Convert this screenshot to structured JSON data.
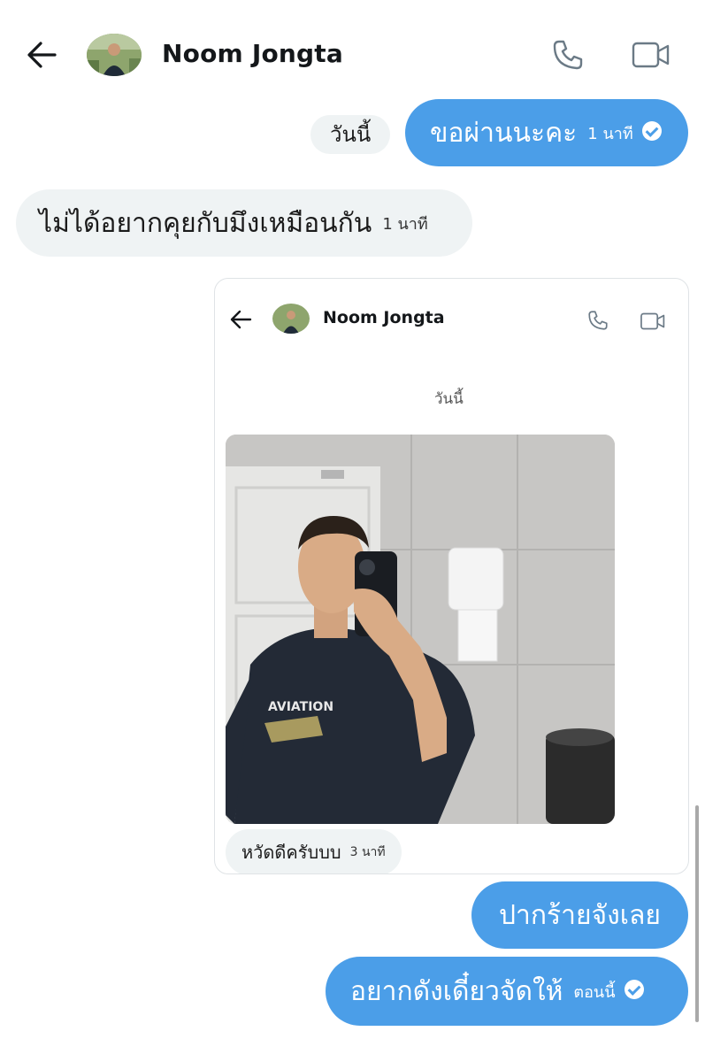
{
  "header": {
    "contact_name": "Noom Jongta",
    "icons": [
      "back-arrow-icon",
      "phone-icon",
      "video-camera-icon"
    ]
  },
  "day_label": "วันนี้",
  "messages": [
    {
      "side": "sent",
      "text": "ขอผ่านนะคะ",
      "time": "1 นาที",
      "status": "read"
    },
    {
      "side": "received",
      "text": "ไม่ได้อยากคุยกับมึงเหมือนกัน",
      "time": "1 นาที"
    },
    {
      "side": "sent",
      "text": "ปากร้ายจังเลย"
    },
    {
      "side": "sent",
      "text": "อยากดังเดี๋ยวจัดให้",
      "time": "ตอนนี้",
      "status": "read"
    }
  ],
  "embedded_screenshot": {
    "contact_name": "Noom Jongta",
    "day_label": "วันนี้",
    "photo_shirt_text": "AVIATION",
    "caption": {
      "text": "หวัดดีครับบบ",
      "time": "3 นาที"
    }
  },
  "colors": {
    "sent_bubble": "#4b9ee8",
    "received_bubble": "#eff3f4",
    "text_dark": "#14171a"
  }
}
